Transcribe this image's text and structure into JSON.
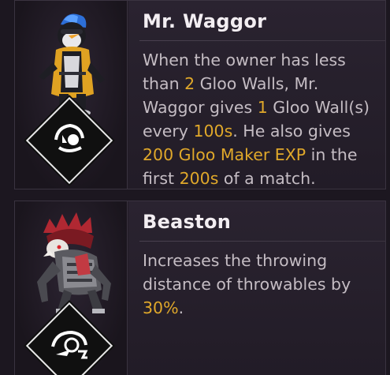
{
  "pets": [
    {
      "name": "Mr. Waggor",
      "description": [
        {
          "t": "When the owner has less than "
        },
        {
          "t": "2",
          "hl": true
        },
        {
          "t": " Gloo Walls, Mr. Waggor gives "
        },
        {
          "t": "1",
          "hl": true
        },
        {
          "t": " Gloo Wall(s) every "
        },
        {
          "t": "100s",
          "hl": true
        },
        {
          "t": ". He also gives "
        },
        {
          "t": "200 Gloo Maker EXP",
          "hl": true
        },
        {
          "t": " in the first "
        },
        {
          "t": "200s",
          "hl": true
        },
        {
          "t": " of a match."
        }
      ],
      "portrait_icon": "penguin-pet-illustration",
      "ability_icon": "gloo-wall-ability-icon"
    },
    {
      "name": "Beaston",
      "description": [
        {
          "t": "Increases the throwing distance of throwables by "
        },
        {
          "t": "30%",
          "hl": true
        },
        {
          "t": "."
        }
      ],
      "portrait_icon": "beast-pet-illustration",
      "ability_icon": "throw-ability-icon"
    }
  ],
  "colors": {
    "highlight": "#e0a82a",
    "text": "#c4bcc3",
    "title": "#f3eef2",
    "panel": "#221c26"
  }
}
